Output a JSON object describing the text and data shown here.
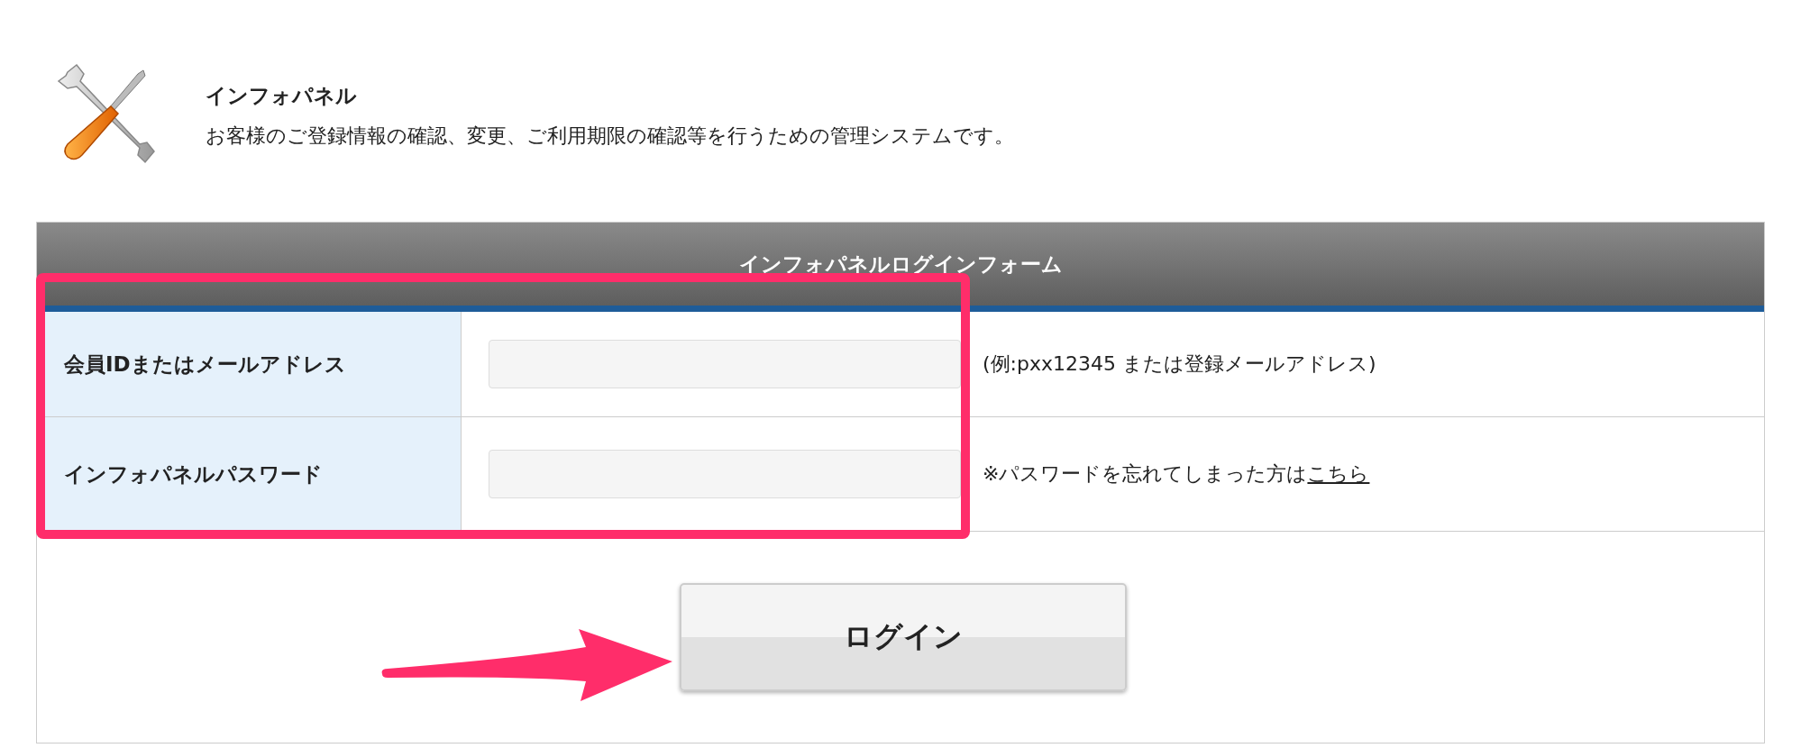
{
  "header": {
    "title": "インフォパネル",
    "description": "お客様のご登録情報の確認、変更、ご利用期限の確認等を行うための管理システムです。"
  },
  "form": {
    "title": "インフォパネルログインフォーム",
    "fields": [
      {
        "label": "会員IDまたはメールアドレス",
        "note": "(例:pxx12345 または登録メールアドレス)"
      },
      {
        "label": "インフォパネルパスワード",
        "note": "※パスワードを忘れてしまった方は",
        "link": "こちら"
      }
    ],
    "submit": "ログイン"
  },
  "highlight": {
    "kind": "frame"
  },
  "pointer": {
    "kind": "arrow"
  }
}
